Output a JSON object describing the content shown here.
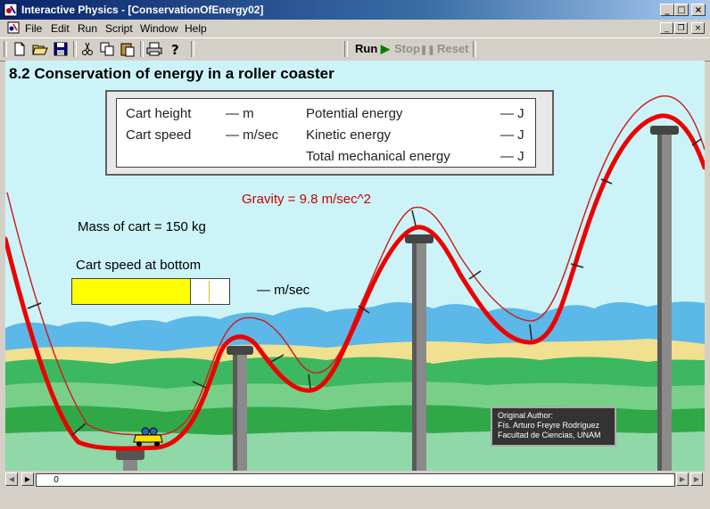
{
  "window": {
    "title": "Interactive Physics - [ConservationOfEnergy02]",
    "controls": [
      "_",
      "□",
      "×"
    ]
  },
  "menu": {
    "items": [
      "File",
      "Edit",
      "Run",
      "Script",
      "Window",
      "Help"
    ],
    "mdi_controls": [
      "_",
      "❐",
      "×"
    ]
  },
  "toolbar": {
    "run_label": "Run",
    "stop_label": "Stop",
    "reset_label": "Reset",
    "icons": [
      "new-icon",
      "open-icon",
      "save-icon",
      "cut-icon",
      "copy-icon",
      "paste-icon",
      "print-icon",
      "help-icon"
    ]
  },
  "simulation": {
    "heading": "8.2 Conservation of energy in a roller coaster",
    "meter": {
      "cart_height_label": "Cart height",
      "cart_height_value": "— m",
      "cart_speed_label": "Cart speed",
      "cart_speed_value": "— m/sec",
      "potential_label": "Potential energy",
      "potential_value": "— J",
      "kinetic_label": "Kinetic energy",
      "kinetic_value": "— J",
      "total_label": "Total mechanical energy",
      "total_value": "— J"
    },
    "gravity_label": "Gravity = 9.8 m/sec^2",
    "mass_label": "Mass of cart = 150 kg",
    "speed_bar_title": "Cart speed at bottom",
    "speed_bar_value": "— m/sec",
    "speed_bar_fill": 0.75,
    "speed_bar_marker": 0.87,
    "credit": {
      "line1": "Original Author:",
      "line2": "Fís. Arturo Freyre Rodríguez",
      "line3": "Facultad de Ciencias, UNAM"
    }
  },
  "status": {
    "frame_value": "0"
  },
  "colors": {
    "sky": "#ccf4f8",
    "track_main": "#ee0000",
    "track_thin": "#cc2222",
    "gravity_text": "#cc0000",
    "speed_fill": "#ffff00",
    "run_green": "#008000"
  }
}
